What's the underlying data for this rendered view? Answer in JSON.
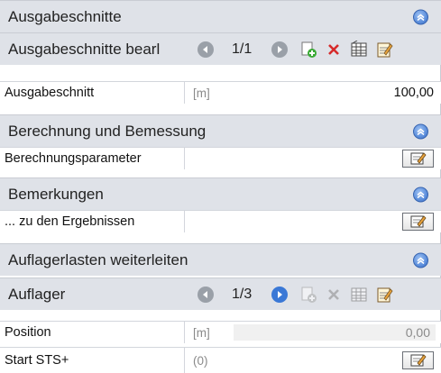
{
  "sections": {
    "ausgabeschnitte": "Ausgabeschnitte",
    "berechnung": "Berechnung und Bemessung",
    "bemerkungen": "Bemerkungen",
    "auflagerlasten": "Auflagerlasten weiterleiten"
  },
  "nav_ausgabeschnitte": {
    "label": "Ausgabeschnitte bearl",
    "counter": "1/1"
  },
  "nav_auflager": {
    "label": "Auflager",
    "counter": "1/3"
  },
  "rows": {
    "ausgabeschnitt": {
      "label": "Ausgabeschnitt",
      "unit": "[m]",
      "value": "100,00"
    },
    "berechnungsparameter": {
      "label": "Berechnungsparameter"
    },
    "ergebnisse": {
      "label": "... zu den Ergebnissen"
    },
    "position": {
      "label": "Position",
      "unit": "[m]",
      "value": "0,00"
    },
    "start_sts": {
      "label": "Start STS+",
      "unit": "(0)"
    }
  },
  "icons": {
    "collapse": "double-chevron-up-icon",
    "add": "add-document-icon",
    "delete": "delete-x-icon",
    "table": "table-icon",
    "edit": "edit-notepad-icon"
  },
  "colors": {
    "header_bg": "#dfe2e8",
    "accent_blue": "#3a78d6",
    "delete_red": "#d62a2a"
  }
}
